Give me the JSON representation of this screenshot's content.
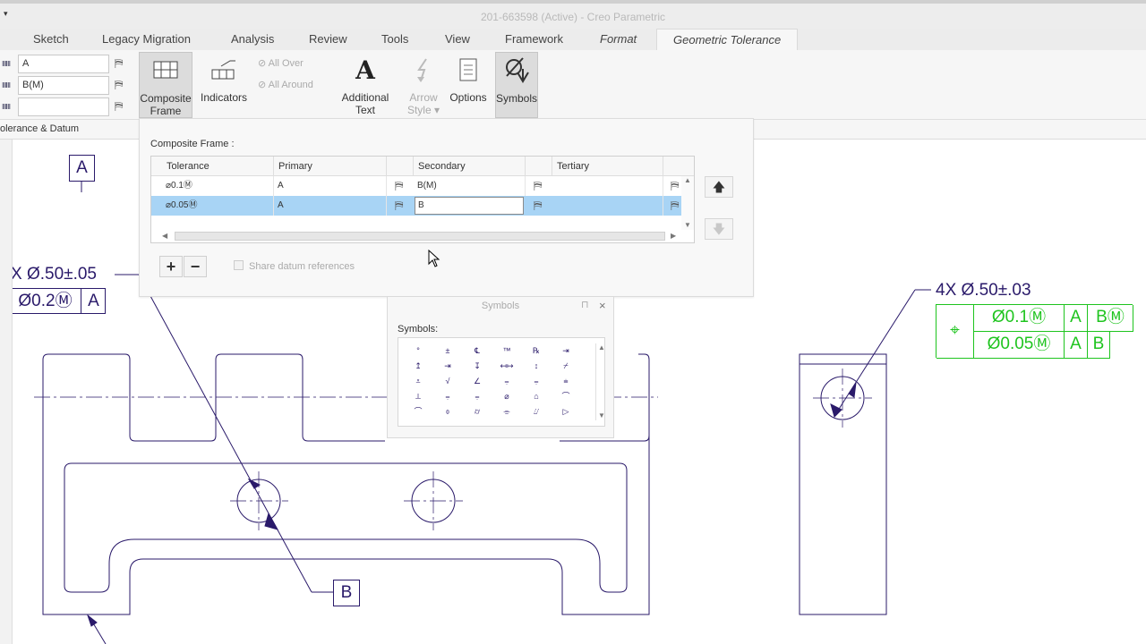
{
  "window": {
    "title": "201-663598 (Active) - Creo Parametric",
    "sysmenu_glyph": "▾"
  },
  "tabs": [
    {
      "label": "Sketch"
    },
    {
      "label": "Legacy Migration"
    },
    {
      "label": "Analysis"
    },
    {
      "label": "Review"
    },
    {
      "label": "Tools"
    },
    {
      "label": "View"
    },
    {
      "label": "Framework"
    },
    {
      "label": "Format"
    },
    {
      "label": "Geometric Tolerance"
    }
  ],
  "ribbon": {
    "datum_fields": [
      {
        "value": "A"
      },
      {
        "value": "B(M)"
      },
      {
        "value": ""
      }
    ],
    "datum_icon_glyph": "ⅢⅢ",
    "pick_glyph": "⛿",
    "buttons": {
      "composite_frame": "Composite\nFrame",
      "indicators": "Indicators",
      "all_over": "All Over",
      "all_around": "All Around",
      "additional_text": "Additional\nText",
      "arrow_style": "Arrow\nStyle ▾",
      "options": "Options",
      "symbols": "Symbols"
    },
    "group_label": "olerance & Datum"
  },
  "composite_frame": {
    "heading": "Composite Frame :",
    "columns": [
      "Tolerance",
      "Primary",
      "Secondary",
      "Tertiary"
    ],
    "rows": [
      {
        "tolerance": "⌀0.1Ⓜ",
        "primary": "A",
        "secondary": "B(M)",
        "tertiary": ""
      },
      {
        "tolerance": "⌀0.05Ⓜ",
        "primary": "A",
        "secondary": "B",
        "tertiary": ""
      }
    ],
    "add_glyph": "+",
    "remove_glyph": "−",
    "share_label": "Share datum references",
    "up_glyph": "🡅",
    "down_glyph": "🡇"
  },
  "symbols_panel": {
    "title": "Symbols",
    "label": "Symbols:",
    "close_glyph": "×",
    "pin_glyph": "⊓",
    "glyphs": [
      "°",
      "±",
      "℄",
      "™",
      "℞",
      "⇥",
      "↥",
      "⇥",
      "↧",
      "↤↦",
      "↕",
      "⌿",
      "⩡",
      "√",
      "∠",
      "⩦",
      "⩦",
      "⩧",
      "⟂",
      "⩦",
      "⩦",
      "⌀",
      "⌂",
      "⌒",
      "⌒",
      "⌽",
      "⌭",
      "⌯",
      "⌰",
      "▷"
    ]
  },
  "drawing": {
    "datum_a": "A",
    "datum_b": "B",
    "left_dim": "X Ø.50±.05",
    "left_fcf": {
      "tol": "Ø0.2Ⓜ",
      "datum": "A"
    },
    "right_dim": "4X Ø.50±.03",
    "right_fcf": {
      "symbol": "⌖",
      "row1": {
        "tol": "Ø0.1Ⓜ",
        "d1": "A",
        "d2": "BⓂ"
      },
      "row2": {
        "tol": "Ø0.05Ⓜ",
        "d1": "A",
        "d2": "B"
      }
    },
    "colors": {
      "geometry": "#2a1a6a",
      "preview": "#1ec41e",
      "selection": "#a8d4f5"
    }
  }
}
